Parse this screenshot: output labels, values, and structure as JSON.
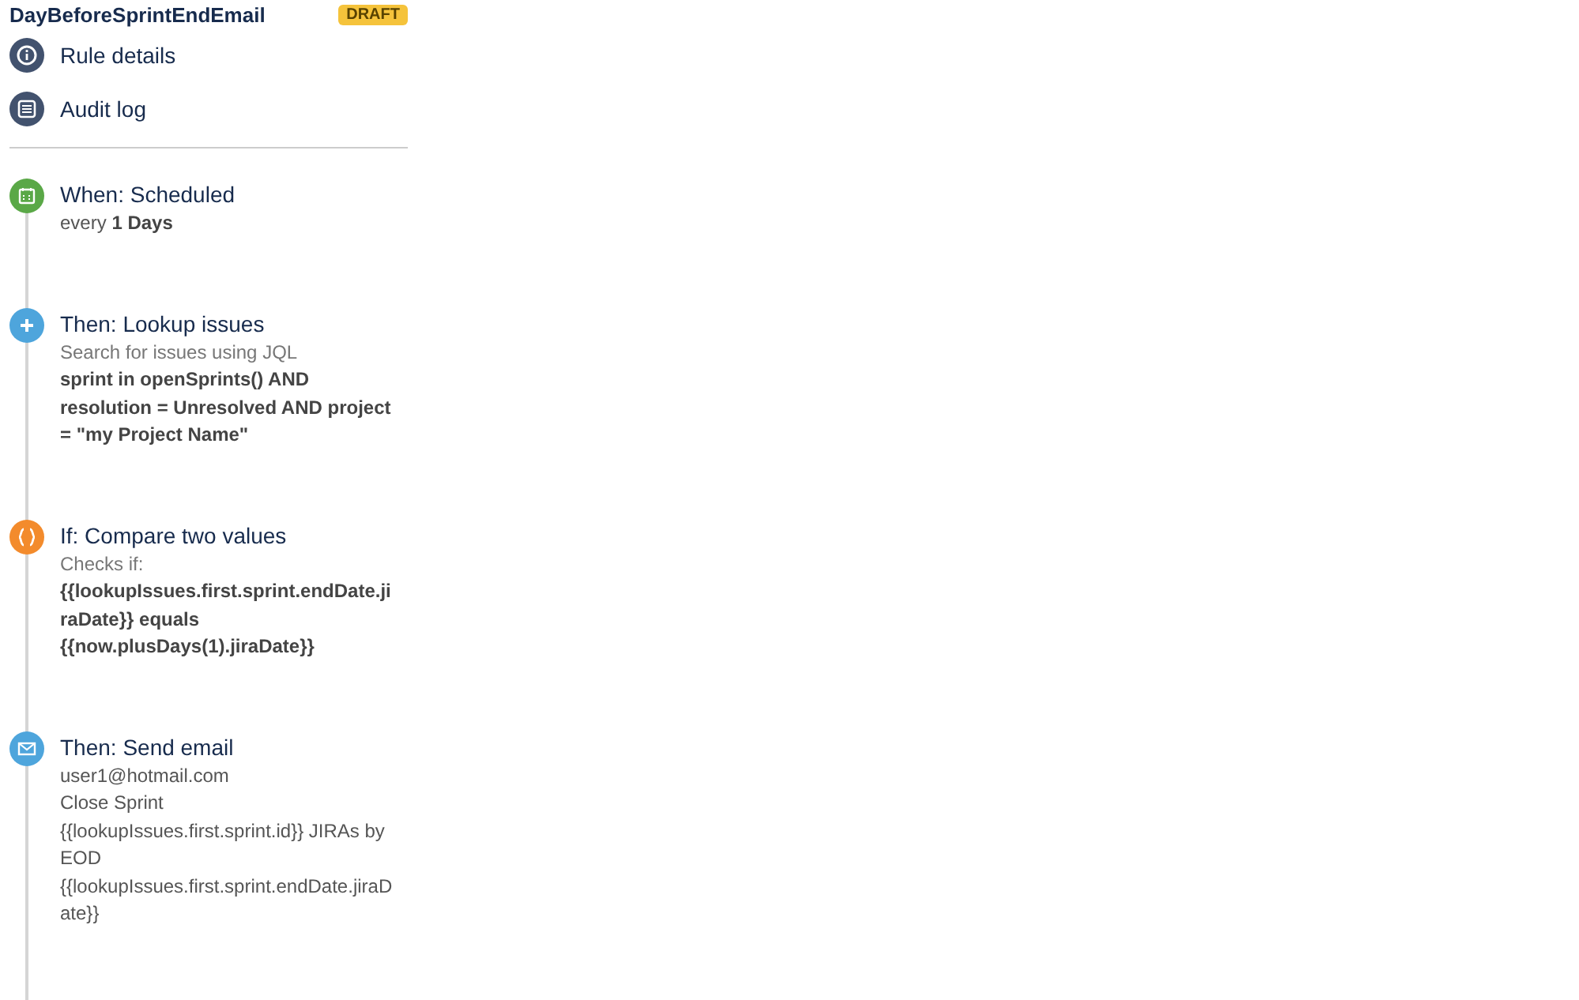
{
  "rule": {
    "title": "DayBeforeSprintEndEmail",
    "status": "DRAFT"
  },
  "nav": [
    {
      "label": "Rule details",
      "kind": "info"
    },
    {
      "label": "Audit log",
      "kind": "list"
    }
  ],
  "steps": [
    {
      "kind": "trigger",
      "heading": "When: Scheduled",
      "lines": [
        "every **1 Days**"
      ]
    },
    {
      "kind": "lookup",
      "heading": "Then: Lookup issues",
      "lines": [
        "Search for issues using JQL",
        "**sprint in openSprints() AND resolution = Unresolved AND project = \"my Project Name\"**"
      ]
    },
    {
      "kind": "condition",
      "heading": "If: Compare two values",
      "lines": [
        "Checks if:",
        "**{{lookupIssues.first.sprint.endDate.jiraDate}} equals {{now.plusDays(1).jiraDate}}**"
      ]
    },
    {
      "kind": "email",
      "heading": "Then: Send email",
      "lines": [
        "user1@hotmail.com",
        "Close Sprint {{lookupIssues.first.sprint.id}} JIRAs by EOD {{lookupIssues.first.sprint.endDate.jiraDate}}"
      ]
    }
  ]
}
